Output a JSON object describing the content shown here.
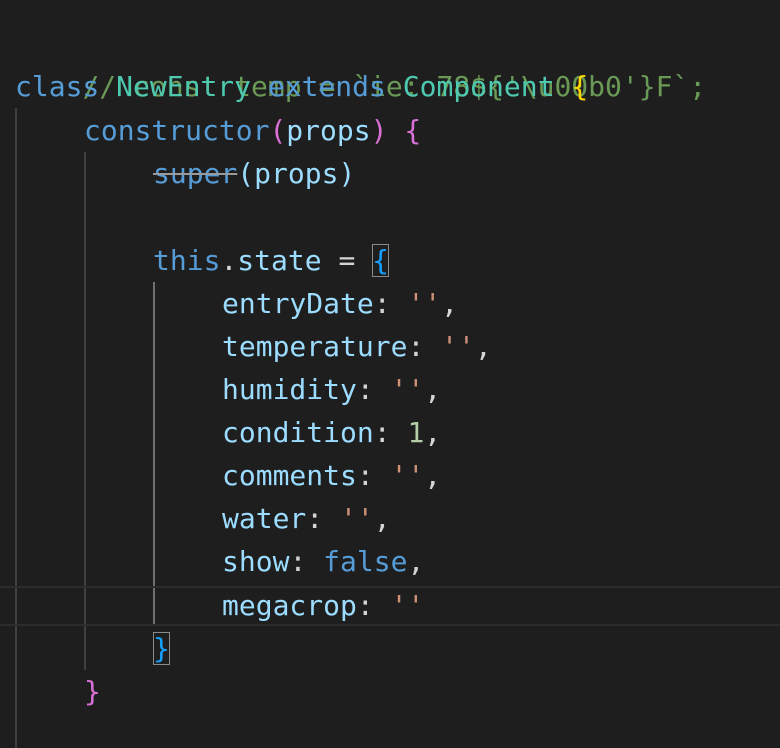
{
  "editor": {
    "lines": {
      "l1": {
        "comment": "// const temp = `ie: 78${'\\u00b0'}F`;"
      },
      "l2": {
        "kw_class": "class",
        "class_name": "NewEntry",
        "kw_extends": "extends",
        "base_class": "Component",
        "open_brace": "{"
      },
      "l3": {
        "ctor": "constructor",
        "open_paren": "(",
        "param": "props",
        "close_paren": ")",
        "open_brace": "{"
      },
      "l4": {
        "super_kw": "super",
        "args": "(props)"
      },
      "l5": {
        "this_kw": "this",
        "dot": ".",
        "prop": "state",
        "eq": " = ",
        "open_brace": "{"
      },
      "props": [
        {
          "key": "entryDate",
          "colon": ": ",
          "value": "''",
          "type": "str",
          "comma": ","
        },
        {
          "key": "temperature",
          "colon": ": ",
          "value": "''",
          "type": "str",
          "comma": ","
        },
        {
          "key": "humidity",
          "colon": ": ",
          "value": "''",
          "type": "str",
          "comma": ","
        },
        {
          "key": "condition",
          "colon": ": ",
          "value": "1",
          "type": "num",
          "comma": ","
        },
        {
          "key": "comments",
          "colon": ": ",
          "value": "''",
          "type": "str",
          "comma": ","
        },
        {
          "key": "water",
          "colon": ": ",
          "value": "''",
          "type": "str",
          "comma": ","
        },
        {
          "key": "show",
          "colon": ": ",
          "value": "false",
          "type": "kw",
          "comma": ","
        },
        {
          "key": "megacrop",
          "colon": ": ",
          "value": "''",
          "type": "str",
          "comma": ""
        }
      ],
      "close_state": "}",
      "close_ctor": "}"
    }
  },
  "colors": {
    "background": "#1e1e1e",
    "comment": "#6a9955",
    "keyword": "#569cd6",
    "class_name": "#4ec9b0",
    "property": "#9cdcfe",
    "string": "#ce9178",
    "number": "#b5cea8",
    "bracket_level1": "#ffd700",
    "bracket_level2": "#da70d6",
    "bracket_level3": "#179fff"
  }
}
